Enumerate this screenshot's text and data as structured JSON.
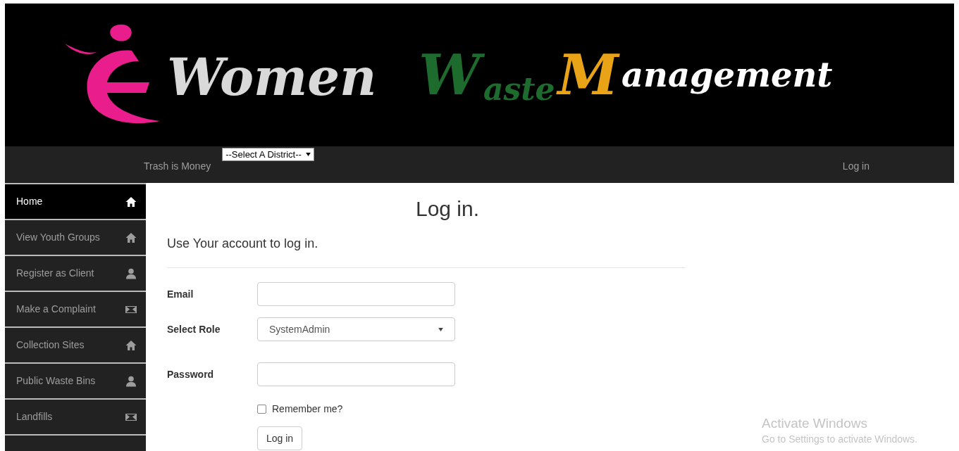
{
  "banner": {
    "logo_parts": [
      {
        "text": "Women",
        "color": "#d9d9d9"
      },
      {
        "text": "W",
        "color": "#1e6b2e"
      },
      {
        "text": "aste",
        "color": "#1e6b2e"
      },
      {
        "text": "M",
        "color": "#e8a317"
      },
      {
        "text": "anagement",
        "color": "#ffffff"
      }
    ]
  },
  "navbar": {
    "tagline": "Trash is Money",
    "district_select": "--Select A District--",
    "login_link": "Log in"
  },
  "sidebar": {
    "items": [
      {
        "label": "Home",
        "kind": "home",
        "selected": true
      },
      {
        "label": "View Youth Groups",
        "kind": "home",
        "selected": false
      },
      {
        "label": "Register as Client",
        "kind": "user",
        "selected": false
      },
      {
        "label": "Make a Complaint",
        "kind": "mail",
        "selected": false
      },
      {
        "label": "Collection Sites",
        "kind": "home",
        "selected": false
      },
      {
        "label": "Public Waste Bins",
        "kind": "user",
        "selected": false
      },
      {
        "label": "Landfills",
        "kind": "mail",
        "selected": false
      }
    ]
  },
  "form": {
    "title": "Log in.",
    "subtitle": "Use Your account to log in.",
    "fields": [
      {
        "kind": "text",
        "label": "Email"
      },
      {
        "kind": "select",
        "label": "Select Role",
        "value": "SystemAdmin"
      },
      {
        "kind": "password",
        "label": "Password"
      }
    ],
    "remember": {
      "label": "Remember me?",
      "checked": false
    },
    "submit": "Log in"
  },
  "os_notice": {
    "title": "Activate Windows",
    "text": "Go to Settings to activate Windows."
  }
}
